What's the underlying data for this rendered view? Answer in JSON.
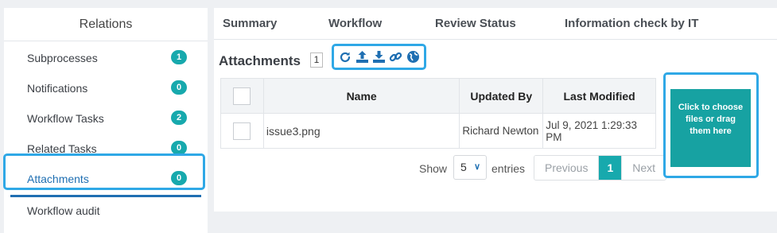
{
  "sidebar": {
    "title": "Relations",
    "items": [
      {
        "label": "Subprocesses",
        "badge": "1"
      },
      {
        "label": "Notifications",
        "badge": "0"
      },
      {
        "label": "Workflow Tasks",
        "badge": "2"
      },
      {
        "label": "Related Tasks",
        "badge": "0"
      },
      {
        "label": "Attachments",
        "badge": "0"
      },
      {
        "label": "Workflow audit"
      }
    ]
  },
  "tabs": [
    "Summary",
    "Workflow",
    "Review Status",
    "Information check by IT"
  ],
  "attachments": {
    "title": "Attachments",
    "count": "1",
    "toolbar_icons": [
      "refresh-icon",
      "upload-icon",
      "download-icon",
      "link-icon",
      "globe-icon"
    ],
    "table": {
      "columns": [
        "Name",
        "Updated By",
        "Last Modified"
      ],
      "rows": [
        {
          "name": "issue3.png",
          "updated_by": "Richard Newton",
          "last_modified": "Jul 9, 2021 1:29:33 PM"
        }
      ]
    },
    "paging": {
      "show_label": "Show",
      "page_size": "5",
      "entries_label": "entries",
      "previous": "Previous",
      "current_page": "1",
      "next": "Next"
    },
    "dropzone_text": "Click to choose files or drag them here"
  },
  "colors": {
    "accent": "#17a9ad",
    "link": "#1f6fb2",
    "highlight": "#2fa8e6"
  }
}
